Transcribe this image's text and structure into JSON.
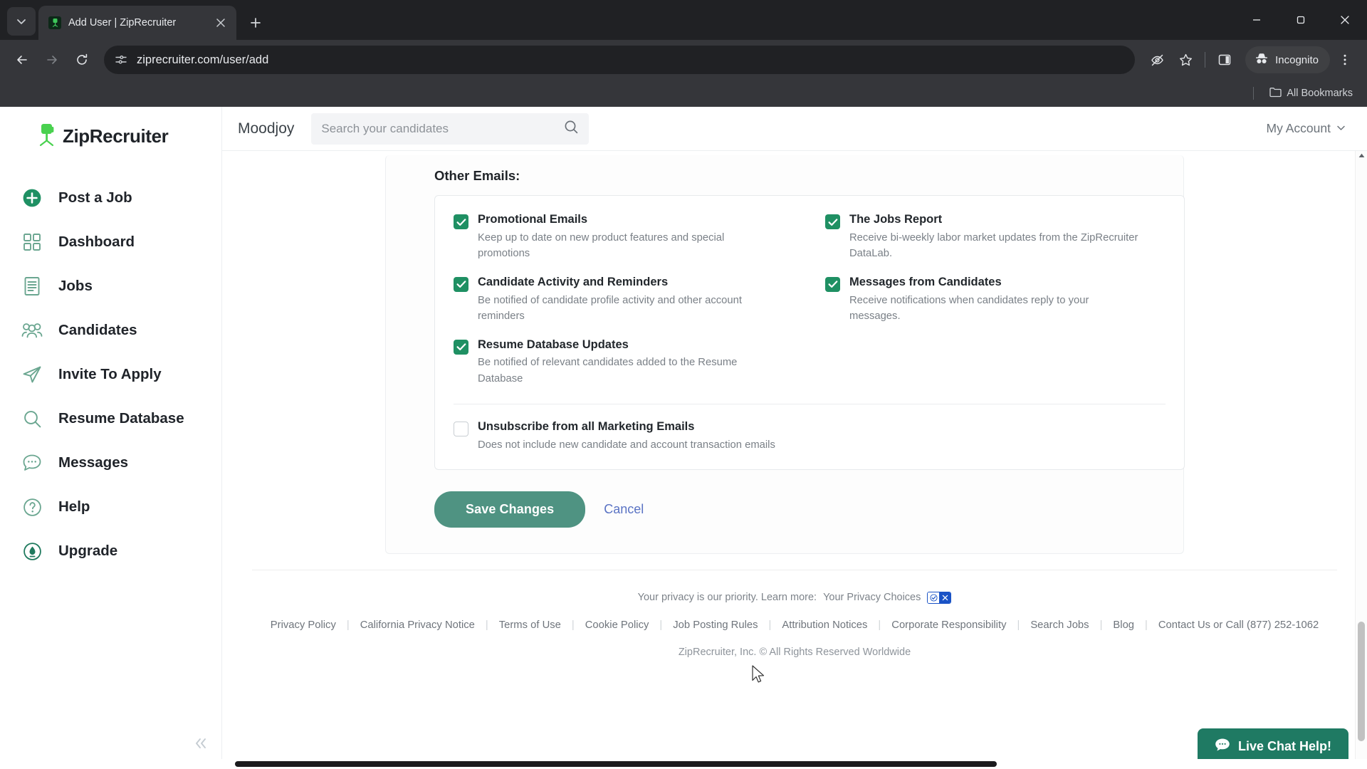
{
  "browser": {
    "tab": {
      "title": "Add User | ZipRecruiter",
      "favicon_icon": "ziprecruiter-favicon",
      "close_icon": "close-icon"
    },
    "tab_list_icon": "chevron-down-icon",
    "new_tab_icon": "plus-icon",
    "window": {
      "minimize": "minimize-icon",
      "maximize": "maximize-icon",
      "close": "close-icon"
    },
    "nav": {
      "back_icon": "back-arrow-icon",
      "forward_icon": "forward-arrow-icon",
      "reload_icon": "reload-icon"
    },
    "omnibox": {
      "url": "ziprecruiter.com/user/add",
      "site_info_icon": "site-settings-icon"
    },
    "toolbar": {
      "tracking_protection_icon": "eye-off-icon",
      "bookmark_icon": "star-icon",
      "side_panel_icon": "side-panel-icon",
      "incognito_label": "Incognito",
      "incognito_icon": "incognito-icon",
      "menu_icon": "kebab-menu-icon"
    },
    "bookmarks_bar": {
      "label": "All Bookmarks",
      "icon": "folder-icon"
    }
  },
  "sidebar": {
    "brand": {
      "name": "ZipRecruiter",
      "logo_icon": "ziprecruiter-chair-logo"
    },
    "items": [
      {
        "label": "Post a Job",
        "icon": "plus-circle-icon"
      },
      {
        "label": "Dashboard",
        "icon": "grid-icon"
      },
      {
        "label": "Jobs",
        "icon": "document-lines-icon"
      },
      {
        "label": "Candidates",
        "icon": "people-icon"
      },
      {
        "label": "Invite To Apply",
        "icon": "paper-plane-icon"
      },
      {
        "label": "Resume Database",
        "icon": "magnifier-icon"
      },
      {
        "label": "Messages",
        "icon": "chat-bubble-icon"
      },
      {
        "label": "Help",
        "icon": "question-circle-icon"
      },
      {
        "label": "Upgrade",
        "icon": "up-arrow-circle-icon"
      }
    ],
    "collapse_icon": "double-chevron-left-icon"
  },
  "topbar": {
    "company": "Moodjoy",
    "search_placeholder": "Search your candidates",
    "search_icon": "search-icon",
    "account_label": "My Account",
    "account_caret_icon": "chevron-down-icon"
  },
  "main": {
    "section_title": "Other Emails:",
    "preferences": [
      {
        "label": "Promotional Emails",
        "description": "Keep up to date on new product features and special promotions",
        "checked": true,
        "column": "left"
      },
      {
        "label": "The Jobs Report",
        "description": "Receive bi-weekly labor market updates from the ZipRecruiter DataLab.",
        "checked": true,
        "column": "right"
      },
      {
        "label": "Candidate Activity and Reminders",
        "description": "Be notified of candidate profile activity and other account reminders",
        "checked": true,
        "column": "left"
      },
      {
        "label": "Messages from Candidates",
        "description": "Receive notifications when candidates reply to your messages.",
        "checked": true,
        "column": "right"
      },
      {
        "label": "Resume Database Updates",
        "description": "Be notified of relevant candidates added to the Resume Database",
        "checked": true,
        "column": "left"
      }
    ],
    "unsubscribe": {
      "label": "Unsubscribe from all Marketing Emails",
      "description": "Does not include new candidate and account transaction emails",
      "checked": false
    },
    "save_label": "Save Changes",
    "cancel_label": "Cancel",
    "accent_color": "#1f9063",
    "save_button_color": "#4f9382"
  },
  "footer": {
    "privacy_text": "Your privacy is our priority. Learn more:",
    "privacy_choices_label": "Your Privacy Choices",
    "privacy_badge_icon": "privacy-choices-badge",
    "links": [
      "Privacy Policy",
      "California Privacy Notice",
      "Terms of Use",
      "Cookie Policy",
      "Job Posting Rules",
      "Attribution Notices",
      "Corporate Responsibility",
      "Search Jobs",
      "Blog",
      "Contact Us or Call (877) 252-1062"
    ],
    "copyright": "ZipRecruiter, Inc. © All Rights Reserved Worldwide"
  },
  "live_chat": {
    "label": "Live Chat Help!",
    "icon": "chat-bubble-icon"
  }
}
